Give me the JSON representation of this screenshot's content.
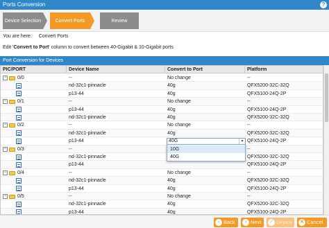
{
  "window": {
    "title": "Ports Conversion",
    "help_glyph": "?"
  },
  "wizard": {
    "steps": [
      {
        "label": "Device Selection",
        "state": "completed"
      },
      {
        "label": "Convert Ports",
        "state": "active"
      },
      {
        "label": "Review",
        "state": "pending"
      }
    ]
  },
  "breadcrumb": {
    "prefix": "You are here:",
    "current": "Convert Ports"
  },
  "instruction": {
    "pre": "Edit '",
    "bold": "Convert to Port",
    "post": "' column to convert between 40-Gigabit & 10-Gigabit ports"
  },
  "panel": {
    "title": "Port Conversion for Devices"
  },
  "table": {
    "columns": [
      "PIC/PORT",
      "Device Name",
      "Convert to Port",
      "Platform"
    ],
    "rows": [
      {
        "type": "group",
        "port": "0/0",
        "device": "--",
        "convert": "No change",
        "platform": "--"
      },
      {
        "type": "device",
        "port": "",
        "device": "nd-32c1-pinnacle",
        "convert": "40g",
        "platform": "QFX5200-32C-32Q"
      },
      {
        "type": "device",
        "port": "",
        "device": "p13-44",
        "convert": "40g",
        "platform": "QFX5100-24Q-2P"
      },
      {
        "type": "group",
        "port": "0/1",
        "device": "--",
        "convert": "No change",
        "platform": "--"
      },
      {
        "type": "device",
        "port": "",
        "device": "p13-44",
        "convert": "40g",
        "platform": "QFX5100-24Q-2P"
      },
      {
        "type": "device",
        "port": "",
        "device": "nd-32c1-pinnacle",
        "convert": "40g",
        "platform": "QFX5200-32C-32Q"
      },
      {
        "type": "group",
        "port": "0/2",
        "device": "--",
        "convert": "No change",
        "platform": "--"
      },
      {
        "type": "device",
        "port": "",
        "device": "nd-32c1-pinnacle",
        "convert": "40g",
        "platform": "QFX5200-32C-32Q"
      },
      {
        "type": "device-edit",
        "port": "",
        "device": "p13-44",
        "convert": "40G",
        "platform": "QFX5100-24Q-2P"
      },
      {
        "type": "group",
        "port": "0/3",
        "device": "--",
        "convert": "",
        "platform": "--"
      },
      {
        "type": "device",
        "port": "",
        "device": "nd-32c1-pinnacle",
        "convert": "",
        "platform": "QFX5200-32C-32Q"
      },
      {
        "type": "device",
        "port": "",
        "device": "p13-44",
        "convert": "",
        "platform": "QFX5100-24Q-2P"
      },
      {
        "type": "group",
        "port": "0/4",
        "device": "--",
        "convert": "No change",
        "platform": "--"
      },
      {
        "type": "device",
        "port": "",
        "device": "nd-32c1-pinnacle",
        "convert": "40g",
        "platform": "QFX5200-32C-32Q"
      },
      {
        "type": "device",
        "port": "",
        "device": "p13-44",
        "convert": "40g",
        "platform": "QFX5100-24Q-2P"
      },
      {
        "type": "group",
        "port": "0/5",
        "device": "--",
        "convert": "No change",
        "platform": "--"
      },
      {
        "type": "device",
        "port": "",
        "device": "nd-32c1-pinnacle",
        "convert": "40g",
        "platform": "QFX5200-32C-32Q"
      },
      {
        "type": "device",
        "port": "",
        "device": "p13-44",
        "convert": "40g",
        "platform": "QFX5100-24Q-2P"
      }
    ]
  },
  "dropdown": {
    "options": [
      "10G",
      "40G"
    ],
    "highlighted": "10G"
  },
  "footer": {
    "back": "Back",
    "next": "Next",
    "deploy": "Deploy",
    "cancel": "Cancel"
  },
  "colors": {
    "header_blue": "#2f86c8",
    "accent_orange": "#f39a26",
    "step_gray": "#8c8c8c"
  }
}
